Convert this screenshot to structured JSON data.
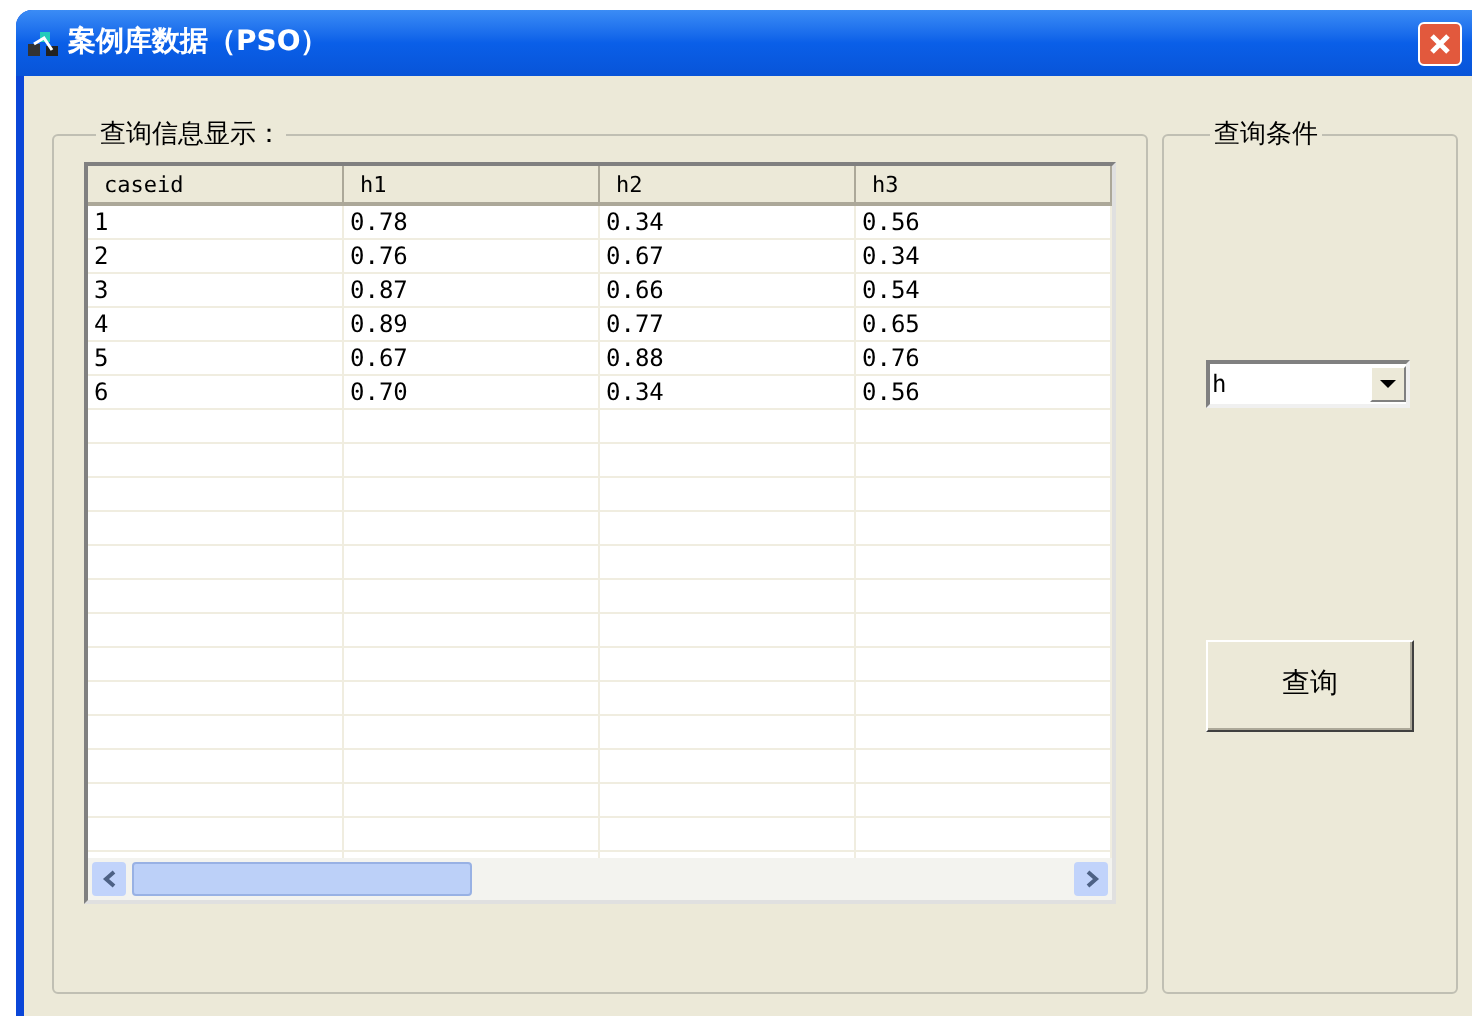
{
  "window": {
    "title": "案例库数据（PSO）"
  },
  "results_group": {
    "title": "查询信息显示："
  },
  "table": {
    "columns": [
      "caseid",
      "h1",
      "h2",
      "h3"
    ],
    "rows": [
      [
        "1",
        "0.78",
        "0.34",
        "0.56"
      ],
      [
        "2",
        "0.76",
        "0.67",
        "0.34"
      ],
      [
        "3",
        "0.87",
        "0.66",
        "0.54"
      ],
      [
        "4",
        "0.89",
        "0.77",
        "0.65"
      ],
      [
        "5",
        "0.67",
        "0.88",
        "0.76"
      ],
      [
        "6",
        "0.70",
        "0.34",
        "0.56"
      ]
    ]
  },
  "query_group": {
    "title": "查询条件",
    "select": {
      "value": "h"
    },
    "button": "查询"
  }
}
